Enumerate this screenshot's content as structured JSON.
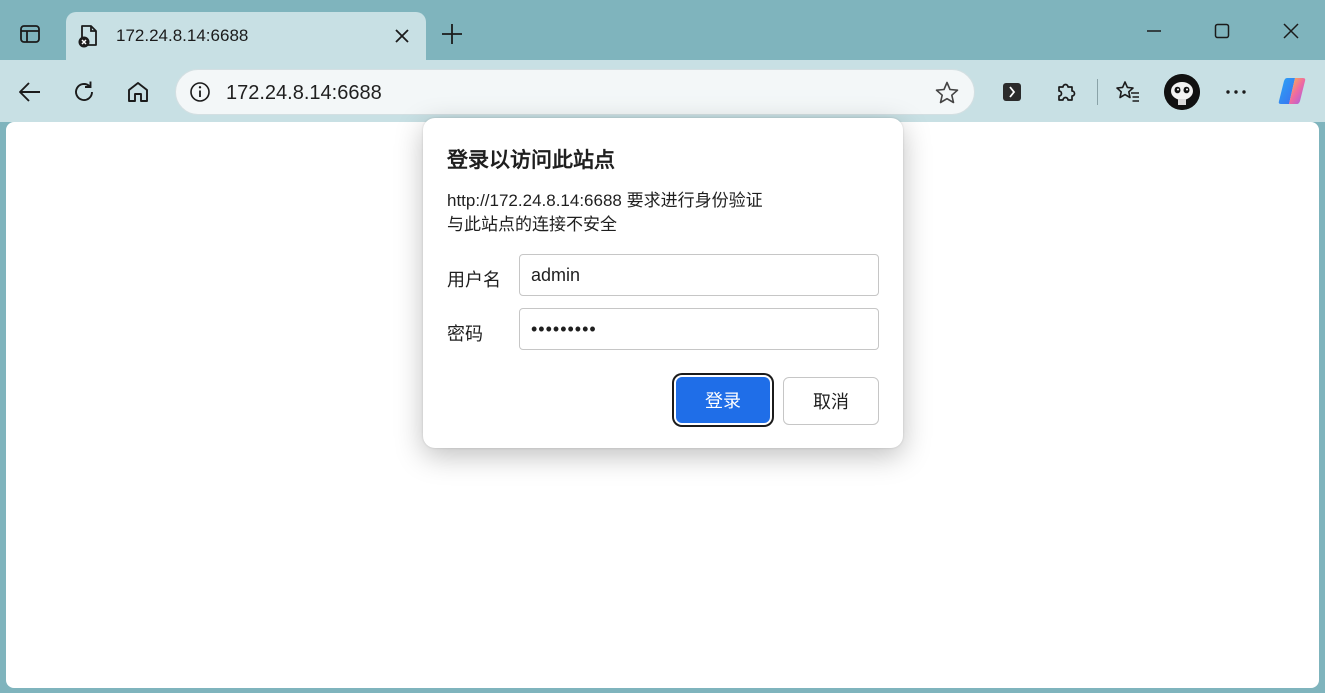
{
  "tab": {
    "title": "172.24.8.14:6688",
    "favicon": "page-error-icon"
  },
  "addressbar": {
    "url": "172.24.8.14:6688"
  },
  "icons": {
    "tab_actions": "tab-actions-icon",
    "tab_close": "close-icon",
    "new_tab": "plus-icon",
    "minimize": "minimize-icon",
    "maximize": "maximize-icon",
    "close_window": "close-icon",
    "back": "back-arrow-icon",
    "refresh": "refresh-icon",
    "home": "home-icon",
    "site_info": "info-icon",
    "favorite": "star-icon",
    "extension_app": "extension-app-icon",
    "extensions": "puzzle-icon",
    "favorites": "favorites-icon",
    "profile": "avatar",
    "more": "more-icon",
    "copilot": "copilot-icon"
  },
  "dialog": {
    "title": "登录以访问此站点",
    "line1": "http://172.24.8.14:6688 要求进行身份验证",
    "line2": "与此站点的连接不安全",
    "username_label": "用户名",
    "username_value": "admin",
    "password_label": "密码",
    "password_value": "•••••••••",
    "login_label": "登录",
    "cancel_label": "取消"
  },
  "colors": {
    "frame": "#7fb4bd",
    "toolbar": "#c8e0e4",
    "primary_button": "#1f6ee8"
  }
}
